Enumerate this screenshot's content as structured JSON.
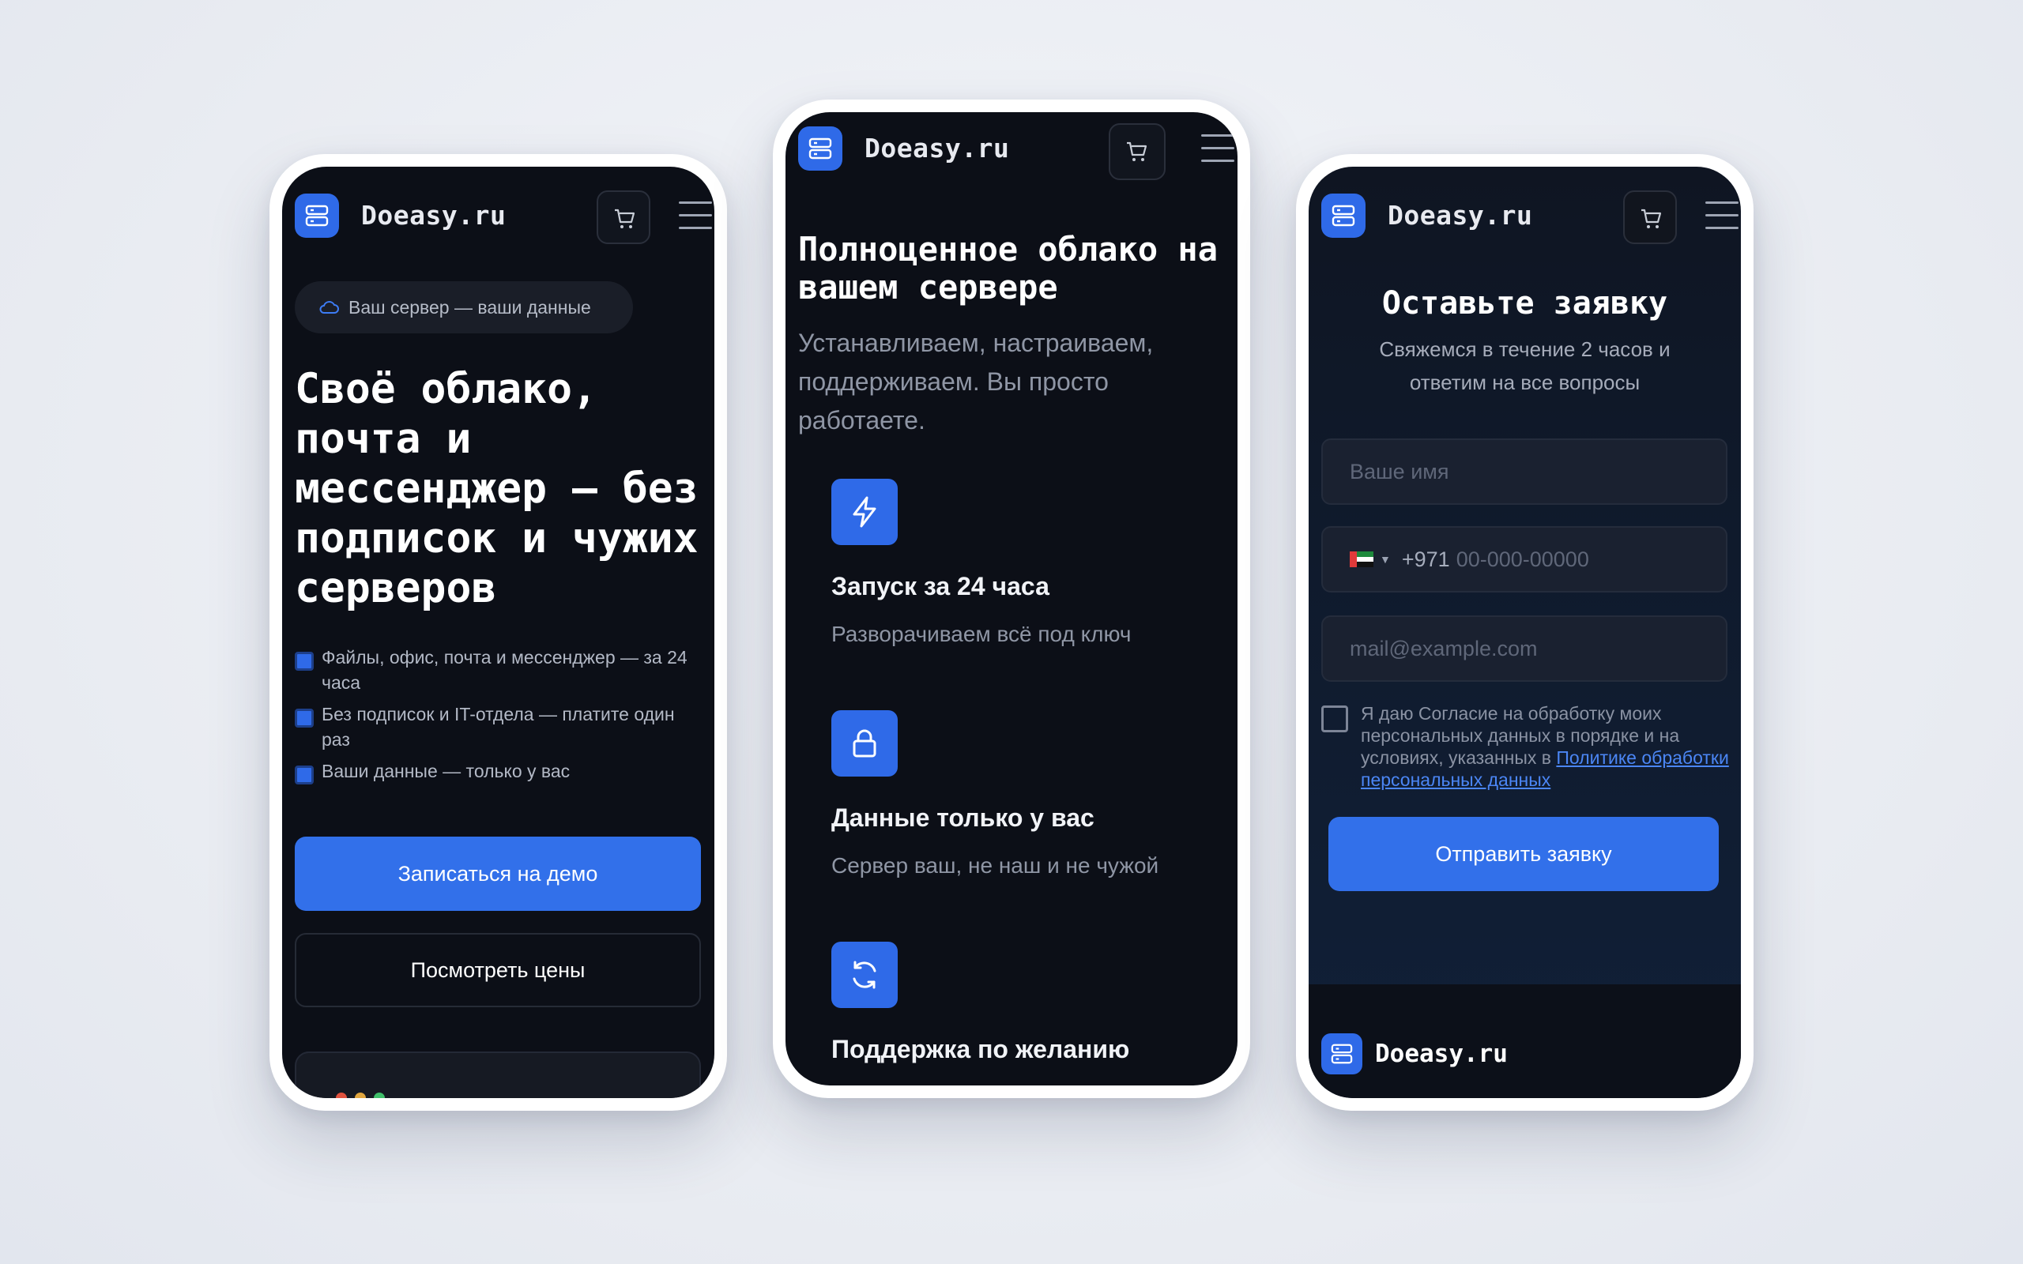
{
  "brand": "Doeasy.ru",
  "colors": {
    "accent": "#2f6ae8",
    "background": "#0c0f17",
    "muted": "#8f96a5"
  },
  "icons": {
    "logo": "server-icon",
    "cart": "cart-icon",
    "menu": "hamburger-menu-icon"
  },
  "phone1": {
    "badge": "Ваш сервер — ваши данные",
    "hero_title": "Своё облако, почта и мессенджер — без подписок и чужих серверов",
    "bullets": [
      "Файлы, офис, почта и мессенджер — за 24 часа",
      "Без подписок и IT-отдела — платите один раз",
      "Ваши данные — только у вас"
    ],
    "primary_button": "Записаться на демо",
    "secondary_button": "Посмотреть цены"
  },
  "phone2": {
    "title": "Полноценное облако на вашем сервере",
    "subtitle": "Устанавливаем, настраиваем, поддерживаем. Вы просто работаете.",
    "features": [
      {
        "icon": "lightning-icon",
        "title": "Запуск за 24 часа",
        "desc": "Разворачиваем всё под ключ"
      },
      {
        "icon": "lock-icon",
        "title": "Данные только у вас",
        "desc": "Сервер ваш, не наш и не чужой"
      },
      {
        "icon": "refresh-icon",
        "title": "Поддержка по желанию",
        "desc": ""
      }
    ]
  },
  "phone3": {
    "title": "Оставьте заявку",
    "subtitle": "Свяжемся в течение 2 часов и ответим на все вопросы",
    "name_placeholder": "Ваше имя",
    "phone_code": "+971",
    "phone_placeholder": "00-000-00000",
    "email_placeholder": "mail@example.com",
    "consent_text": "Я даю Согласие на обработку моих персональных данных в порядке и на условиях, указанных в ",
    "consent_link": "Политике обработки персональных данных",
    "submit_button": "Отправить заявку"
  }
}
